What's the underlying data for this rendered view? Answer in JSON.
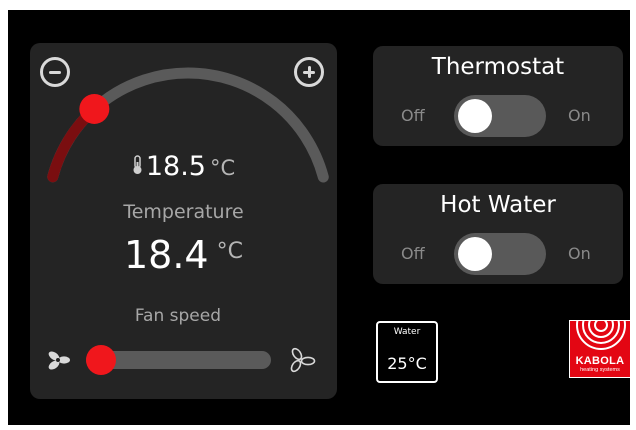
{
  "climate": {
    "setpoint_value": "18.5",
    "setpoint_unit": "°C",
    "temperature_label": "Temperature",
    "actual_value": "18.4",
    "actual_unit": "°C",
    "fan_speed_label": "Fan speed",
    "fan_speed_level": 0.08,
    "setpoint_level": 0.22
  },
  "thermostat": {
    "title": "Thermostat",
    "off_label": "Off",
    "on_label": "On",
    "state": "off"
  },
  "hot_water": {
    "title": "Hot Water",
    "off_label": "Off",
    "on_label": "On",
    "state": "off"
  },
  "water_indicator": {
    "label": "Water",
    "value": "25°C"
  },
  "logo": {
    "brand": "KABOLA",
    "tagline": "heating systems"
  },
  "colors": {
    "accent": "#f0171c",
    "panel": "#242424",
    "background": "#000000",
    "arc_inactive": "#5a5a5a"
  },
  "icons": [
    "minus-icon",
    "plus-icon",
    "thermometer-icon",
    "fan-low-icon",
    "fan-high-icon"
  ]
}
